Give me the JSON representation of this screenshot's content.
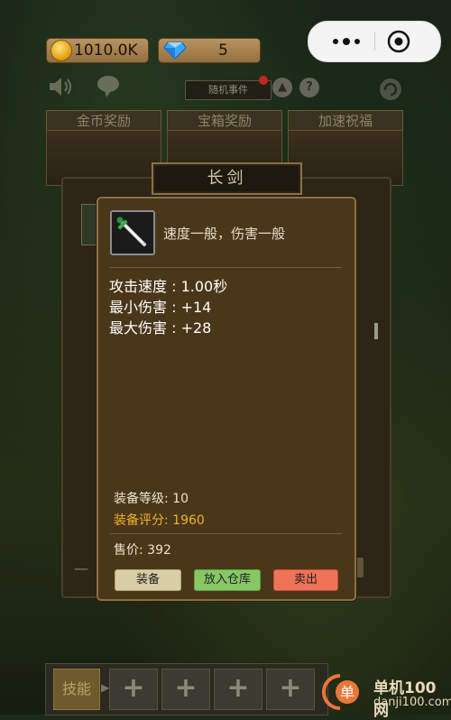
{
  "hud": {
    "coins": "1010.0K",
    "gems": "5",
    "event_button": "随机事件",
    "help_icon": "?",
    "up_icon": "▲"
  },
  "capsule": {
    "more_icon": "more-dots-icon",
    "close_icon": "target-close-icon"
  },
  "reward_tabs": [
    "金币奖励",
    "宝箱奖励",
    "加速祝福"
  ],
  "background_panel": {
    "title": "长剑",
    "bottom_left_fragment": "一"
  },
  "item": {
    "icon": "sword-icon",
    "description": "速度一般，伤害一般",
    "stats": [
      "攻击速度 : 1.00秒",
      "最小伤害 : +14",
      "最大伤害 : +28"
    ],
    "equip_level": "装备等级: 10",
    "equip_score": "装备评分: 1960",
    "price": "售价:  392"
  },
  "actions": {
    "equip": "装备",
    "store": "放入仓库",
    "sell": "卖出"
  },
  "bottom": {
    "skill_label": "技能",
    "slot_symbol": "+"
  },
  "watermark": {
    "line1": "单机100网",
    "line2": "danji100.com"
  },
  "colors": {
    "popup_bg": "#4a3719",
    "gold_text": "#f0b22d",
    "equip_btn": "#d9cda5",
    "store_btn": "#87c765",
    "sell_btn": "#ef7358"
  }
}
